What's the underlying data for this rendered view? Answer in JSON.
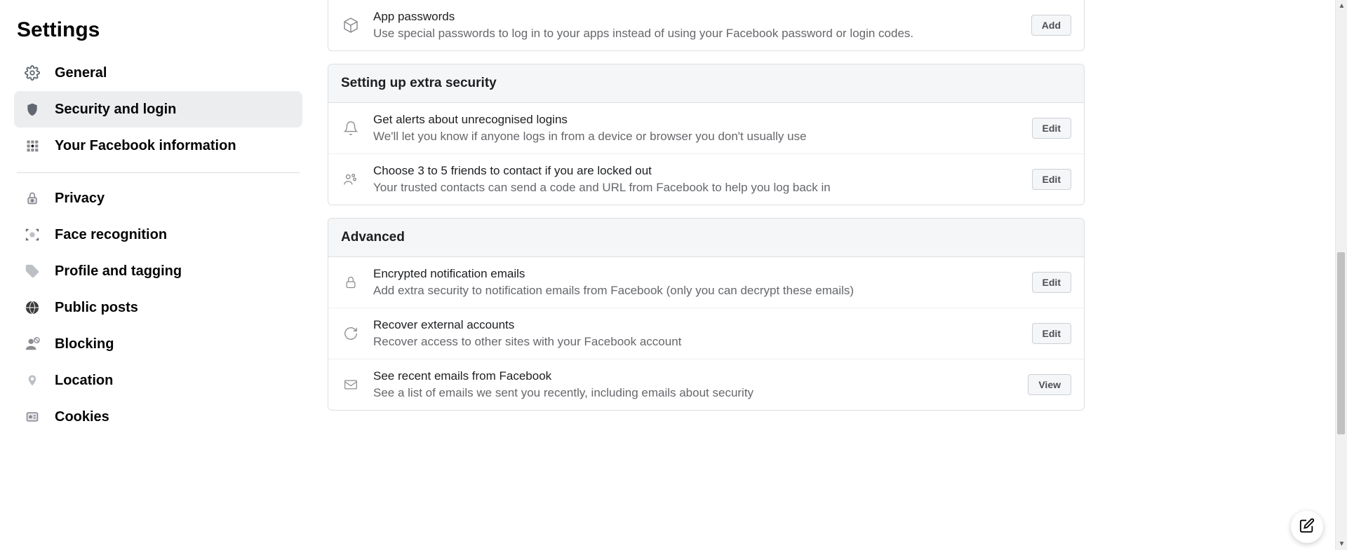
{
  "sidebar": {
    "title": "Settings",
    "items": [
      {
        "label": "General",
        "icon": "gear"
      },
      {
        "label": "Security and login",
        "icon": "shield"
      },
      {
        "label": "Your Facebook information",
        "icon": "grid"
      },
      {
        "label": "Privacy",
        "icon": "lock-person"
      },
      {
        "label": "Face recognition",
        "icon": "face-scan"
      },
      {
        "label": "Profile and tagging",
        "icon": "tag"
      },
      {
        "label": "Public posts",
        "icon": "globe"
      },
      {
        "label": "Blocking",
        "icon": "block-person"
      },
      {
        "label": "Location",
        "icon": "pin"
      },
      {
        "label": "Cookies",
        "icon": "id"
      }
    ]
  },
  "sections": [
    {
      "header": null,
      "rows": [
        {
          "title": "App passwords",
          "desc": "Use special passwords to log in to your apps instead of using your Facebook password or login codes.",
          "action": "Add",
          "icon": "cube"
        }
      ]
    },
    {
      "header": "Setting up extra security",
      "rows": [
        {
          "title": "Get alerts about unrecognised logins",
          "desc": "We'll let you know if anyone logs in from a device or browser you don't usually use",
          "action": "Edit",
          "icon": "bell"
        },
        {
          "title": "Choose 3 to 5 friends to contact if you are locked out",
          "desc": "Your trusted contacts can send a code and URL from Facebook to help you log back in",
          "action": "Edit",
          "icon": "friends"
        }
      ]
    },
    {
      "header": "Advanced",
      "rows": [
        {
          "title": "Encrypted notification emails",
          "desc": "Add extra security to notification emails from Facebook (only you can decrypt these emails)",
          "action": "Edit",
          "icon": "padlock"
        },
        {
          "title": "Recover external accounts",
          "desc": "Recover access to other sites with your Facebook account",
          "action": "Edit",
          "icon": "refresh"
        },
        {
          "title": "See recent emails from Facebook",
          "desc": "See a list of emails we sent you recently, including emails about security",
          "action": "View",
          "icon": "mail"
        }
      ]
    }
  ]
}
